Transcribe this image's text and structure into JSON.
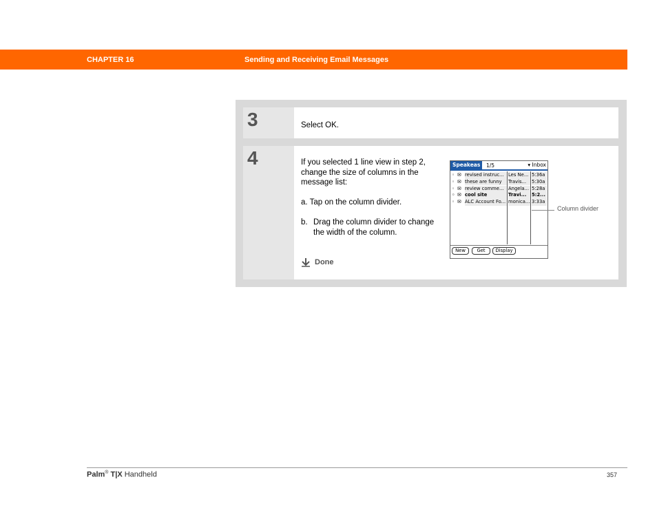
{
  "header": {
    "chapter": "CHAPTER 16",
    "title": "Sending and Receiving Email Messages",
    "bar_color": "#ff6600"
  },
  "steps": [
    {
      "number": "3",
      "text": "Select OK."
    },
    {
      "number": "4",
      "intro": "If you selected 1 line view in step 2, change the size of columns in the message list:",
      "sub_a": "a.  Tap on the column divider.",
      "sub_b_marker": "b.",
      "sub_b": "Drag the column divider to change the width of the column.",
      "done_label": "Done",
      "done_icon": "down-arrow-icon"
    }
  ],
  "palm_screen": {
    "app_name": "Speakeas",
    "count": "1/5",
    "folder": "▾ Inbox",
    "messages": [
      {
        "subject": "revised instruc...",
        "from": "Les Ne...",
        "time": "5:36a",
        "icon": "attachment-envelope-icon",
        "bold": false
      },
      {
        "subject": "these are funny",
        "from": "Travis...",
        "time": "5:30a",
        "icon": "attachment-envelope-icon",
        "bold": false
      },
      {
        "subject": "review comme...",
        "from": "Angela...",
        "time": "5:28a",
        "icon": "envelope-icon",
        "bold": false
      },
      {
        "subject": "cool site",
        "from": "Travi...",
        "time": "5:2...",
        "icon": "envelope-icon",
        "bold": true
      },
      {
        "subject": "ALC Account Fo...",
        "from": "monica...",
        "time": "3:33a",
        "icon": "envelope-icon",
        "bold": false
      }
    ],
    "buttons": [
      "New",
      "Get",
      "Display"
    ],
    "accent_color": "#1f5aa6"
  },
  "callout": {
    "label": "Column divider"
  },
  "footer": {
    "brand": "Palm",
    "registered": "®",
    "model": "T|X",
    "product": "Handheld",
    "page": "357"
  }
}
